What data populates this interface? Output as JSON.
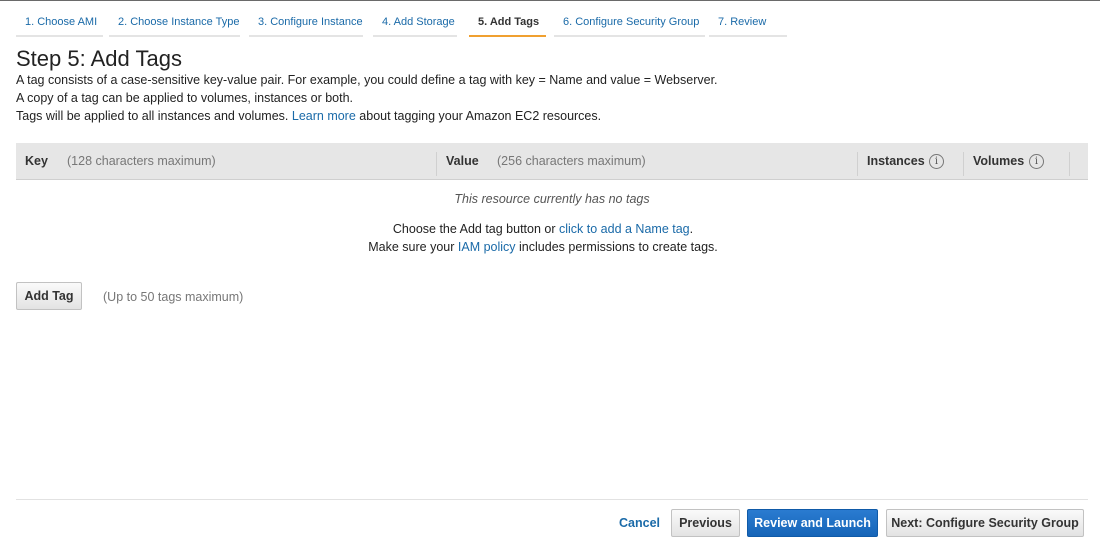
{
  "steps": [
    {
      "label": "1. Choose AMI"
    },
    {
      "label": "2. Choose Instance Type"
    },
    {
      "label": "3. Configure Instance"
    },
    {
      "label": "4. Add Storage"
    },
    {
      "label": "5. Add Tags"
    },
    {
      "label": "6. Configure Security Group"
    },
    {
      "label": "7. Review"
    }
  ],
  "active_step": "5. Add Tags",
  "page": {
    "title": "Step 5: Add Tags",
    "desc_line1": "A tag consists of a case-sensitive key-value pair. For example, you could define a tag with key = Name and value = Webserver.",
    "desc_line2": "A copy of a tag can be applied to volumes, instances or both.",
    "desc_line3_prefix": "Tags will be applied to all instances and volumes.",
    "desc_line3_link": "Learn more",
    "desc_line3_suffix": "about tagging your Amazon EC2 resources."
  },
  "table": {
    "key_header": "Key",
    "key_hint": "(128 characters maximum)",
    "value_header": "Value",
    "value_hint": "(256 characters maximum)",
    "instances_header": "Instances",
    "volumes_header": "Volumes",
    "info_icon_glyph": "i",
    "empty_message": "This resource currently has no tags",
    "add_line_prefix": "Choose the Add tag button or",
    "add_line_link": "click to add a Name tag",
    "add_line_suffix": ".",
    "perm_line_prefix": "Make sure your",
    "perm_line_link": "IAM policy",
    "perm_line_suffix": "includes permissions to create tags."
  },
  "add_tag": {
    "button_label": "Add Tag",
    "limit_hint": "(Up to 50 tags maximum)"
  },
  "footer": {
    "cancel_label": "Cancel",
    "previous_label": "Previous",
    "review_launch_label": "Review and Launch",
    "next_label": "Next: Configure Security Group"
  },
  "colors": {
    "link": "#1a6aa8",
    "active_tab_underline": "#f0a030",
    "primary_button": "#1665b8",
    "table_header_bg": "#e6e6e6"
  }
}
